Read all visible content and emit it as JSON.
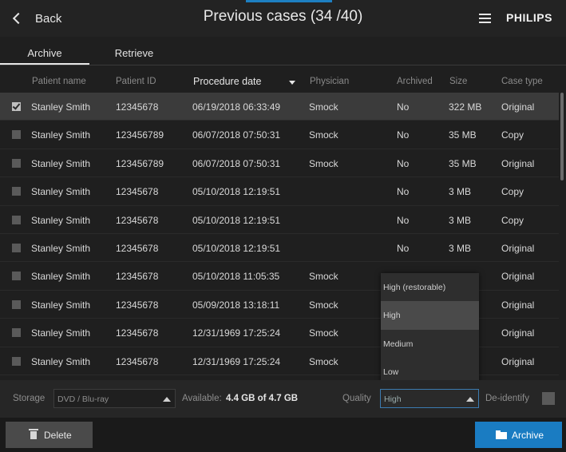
{
  "header": {
    "back_label": "Back",
    "title": "Previous cases (34 /40)",
    "brand": "PHILIPS"
  },
  "tabs": [
    {
      "label": "Archive",
      "active": true
    },
    {
      "label": "Retrieve",
      "active": false
    }
  ],
  "columns": {
    "patient_name": "Patient name",
    "patient_id": "Patient ID",
    "procedure_date": "Procedure date",
    "physician": "Physician",
    "archived": "Archived",
    "size": "Size",
    "case_type": "Case type"
  },
  "rows": [
    {
      "selected": true,
      "name": "Stanley Smith",
      "id": "12345678",
      "date": "06/19/2018 06:33:49",
      "physician": "Smock",
      "archived": "No",
      "size": "322 MB",
      "type": "Original"
    },
    {
      "selected": false,
      "name": "Stanley Smith",
      "id": "123456789",
      "date": "06/07/2018 07:50:31",
      "physician": "Smock",
      "archived": "No",
      "size": "35 MB",
      "type": "Copy"
    },
    {
      "selected": false,
      "name": "Stanley Smith",
      "id": "123456789",
      "date": "06/07/2018 07:50:31",
      "physician": "Smock",
      "archived": "No",
      "size": "35 MB",
      "type": "Original"
    },
    {
      "selected": false,
      "name": "Stanley Smith",
      "id": "12345678",
      "date": "05/10/2018 12:19:51",
      "physician": "",
      "archived": "No",
      "size": "3 MB",
      "type": "Copy"
    },
    {
      "selected": false,
      "name": "Stanley Smith",
      "id": "12345678",
      "date": "05/10/2018 12:19:51",
      "physician": "",
      "archived": "No",
      "size": "3 MB",
      "type": "Copy"
    },
    {
      "selected": false,
      "name": "Stanley Smith",
      "id": "12345678",
      "date": "05/10/2018 12:19:51",
      "physician": "",
      "archived": "No",
      "size": "3 MB",
      "type": "Original"
    },
    {
      "selected": false,
      "name": "Stanley Smith",
      "id": "12345678",
      "date": "05/10/2018 11:05:35",
      "physician": "Smock",
      "archived": "",
      "size": "",
      "type": "Original"
    },
    {
      "selected": false,
      "name": "Stanley Smith",
      "id": "12345678",
      "date": "05/09/2018 13:18:11",
      "physician": "Smock",
      "archived": "",
      "size": "",
      "type": "Original"
    },
    {
      "selected": false,
      "name": "Stanley Smith",
      "id": "12345678",
      "date": "12/31/1969 17:25:24",
      "physician": "Smock",
      "archived": "",
      "size": "",
      "type": "Original"
    },
    {
      "selected": false,
      "name": "Stanley Smith",
      "id": "12345678",
      "date": "12/31/1969 17:25:24",
      "physician": "Smock",
      "archived": "",
      "size": "",
      "type": "Original"
    }
  ],
  "quality_dropdown": {
    "options": [
      "High (restorable)",
      "High",
      "Medium",
      "Low"
    ],
    "highlighted": "High"
  },
  "bottom": {
    "storage_label": "Storage",
    "storage_value": "DVD / Blu-ray",
    "available_label": "Available:",
    "available_value": "4.4 GB of 4.7 GB",
    "quality_label": "Quality",
    "quality_value": "High",
    "deidentify_label": "De-identify"
  },
  "footer": {
    "delete_label": "Delete",
    "archive_label": "Archive"
  },
  "colors": {
    "accent": "#1a7cc2",
    "background": "#1f1f1f",
    "selected_row": "#3b3b3b"
  }
}
